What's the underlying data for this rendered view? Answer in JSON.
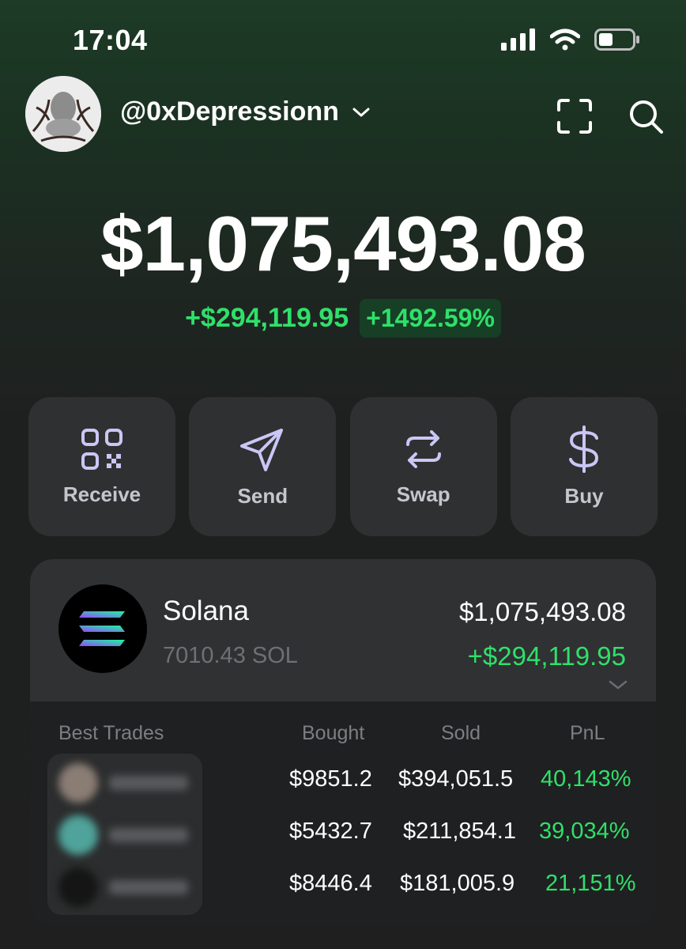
{
  "status_bar": {
    "time": "17:04"
  },
  "header": {
    "username": "@0xDepressionn",
    "icons": [
      "chevron-down-icon",
      "scan-icon",
      "search-icon"
    ]
  },
  "portfolio": {
    "balance": "$1,075,493.08",
    "change_abs": "+$294,119.95",
    "change_pct": "+1492.59%"
  },
  "actions": [
    {
      "label": "Receive",
      "icon": "qr-code-icon"
    },
    {
      "label": "Send",
      "icon": "send-icon"
    },
    {
      "label": "Swap",
      "icon": "swap-icon"
    },
    {
      "label": "Buy",
      "icon": "dollar-icon"
    }
  ],
  "token": {
    "name": "Solana",
    "amount": "7010.43 SOL",
    "value": "$1,075,493.08",
    "change": "+$294,119.95"
  },
  "trades": {
    "headers": {
      "best": "Best Trades",
      "bought": "Bought",
      "sold": "Sold",
      "pnl": "PnL"
    },
    "rows": [
      {
        "bought": "$9851.2",
        "sold": "$394,051.5",
        "pnl": "40,143%"
      },
      {
        "bought": "$5432.7",
        "sold": "$211,854.1",
        "pnl": "39,034%"
      },
      {
        "bought": "$8446.4",
        "sold": "$181,005.9",
        "pnl": "21,151%"
      }
    ]
  },
  "colors": {
    "positive": "#2fe06a",
    "card": "#2f3031",
    "accent_icon": "#c9c7f5"
  }
}
